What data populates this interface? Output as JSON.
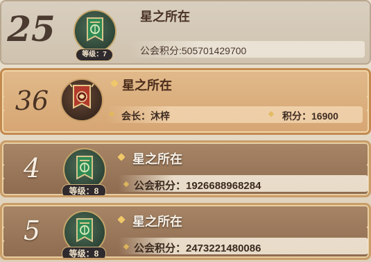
{
  "cards": [
    {
      "rank": "25",
      "name": "星之所在",
      "level": "等级：7",
      "info": "公会积分:505701429700"
    },
    {
      "rank": "36",
      "name": "星之所在",
      "leader": "会长：沐梓",
      "score": "积分：16900"
    },
    {
      "rank": "4",
      "name": "星之所在",
      "level": "等级：8",
      "info": "公会积分：1926688968284"
    },
    {
      "rank": "5",
      "name": "星之所在",
      "level": "等级：8",
      "info": "公会积分：2473221480086"
    }
  ],
  "colors": {
    "highlight_border": "#c28a4f",
    "card_brown": "#8e6b4f",
    "gold_accent": "#f1c869"
  },
  "icons": {
    "emblem_green": "guild-emblem-green-banner-icon",
    "emblem_red": "guild-emblem-red-banner-icon",
    "spark": "sparkle-diamond-icon"
  }
}
